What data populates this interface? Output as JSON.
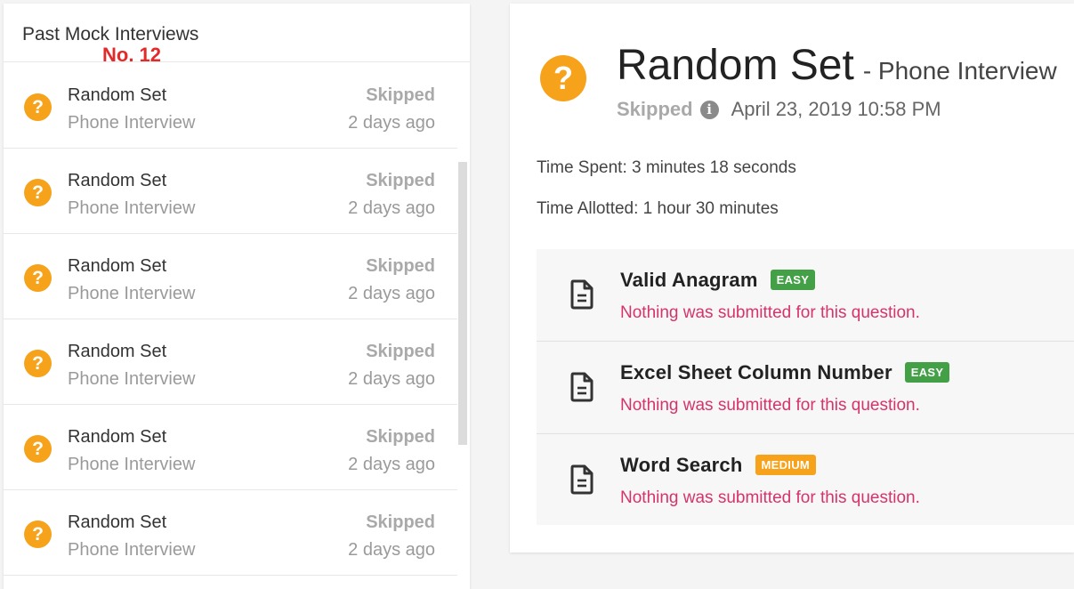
{
  "left_panel": {
    "title": "Past Mock Interviews",
    "overlay_label": "No. 12",
    "items": [
      {
        "title": "Random Set",
        "subtitle": "Phone Interview",
        "status": "Skipped",
        "time": "2 days ago"
      },
      {
        "title": "Random Set",
        "subtitle": "Phone Interview",
        "status": "Skipped",
        "time": "2 days ago"
      },
      {
        "title": "Random Set",
        "subtitle": "Phone Interview",
        "status": "Skipped",
        "time": "2 days ago"
      },
      {
        "title": "Random Set",
        "subtitle": "Phone Interview",
        "status": "Skipped",
        "time": "2 days ago"
      },
      {
        "title": "Random Set",
        "subtitle": "Phone Interview",
        "status": "Skipped",
        "time": "2 days ago"
      },
      {
        "title": "Random Set",
        "subtitle": "Phone Interview",
        "status": "Skipped",
        "time": "2 days ago"
      }
    ]
  },
  "detail": {
    "title": "Random Set",
    "subtitle": "- Phone Interview",
    "status": "Skipped",
    "date": "April 23, 2019 10:58 PM",
    "time_spent": "Time Spent: 3 minutes 18 seconds",
    "time_allotted": "Time Allotted: 1 hour 30 minutes",
    "questions": [
      {
        "name": "Valid Anagram",
        "difficulty": "EASY",
        "message": "Nothing was submitted for this question."
      },
      {
        "name": "Excel Sheet Column Number",
        "difficulty": "EASY",
        "message": "Nothing was submitted for this question."
      },
      {
        "name": "Word Search",
        "difficulty": "MEDIUM",
        "message": "Nothing was submitted for this question."
      }
    ]
  },
  "icons": {
    "status_icon": "question-mark-circle-icon",
    "info_icon": "info-circle-icon",
    "question_icon": "document-icon"
  },
  "colors": {
    "skipped_orange": "#f7a21b",
    "easy_green": "#43a047",
    "medium_orange": "#f7a21b",
    "error_pink": "#d6336c",
    "overlay_red": "#e32a2a"
  }
}
